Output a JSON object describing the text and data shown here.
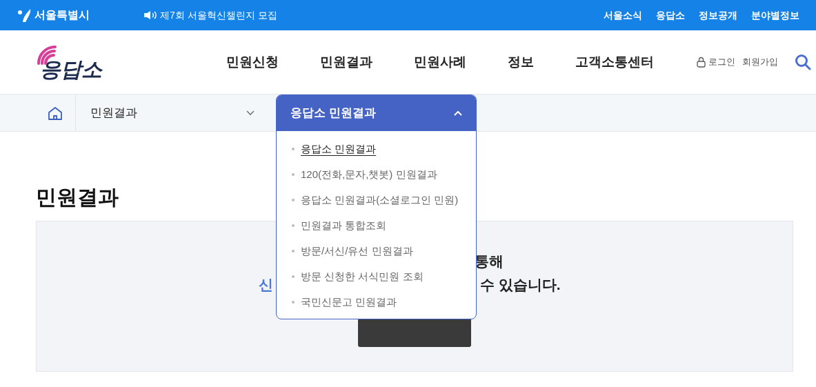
{
  "top_bar": {
    "brand": "서울특별시",
    "notice": "제7회 서울혁신챌린지 모집",
    "links": [
      "서울소식",
      "응답소",
      "정보공개",
      "분야별정보"
    ]
  },
  "header": {
    "logo": "응답소",
    "nav": [
      "민원신청",
      "민원결과",
      "민원사례",
      "정보",
      "고객소통센터"
    ],
    "login": "로그인",
    "signup": "회원가입"
  },
  "breadcrumb": {
    "section": "민원결과",
    "dropdown": {
      "title": "응답소 민원결과",
      "expanded": true,
      "items": [
        {
          "label": "응답소 민원결과",
          "selected": true
        },
        {
          "label": "120(전화,문자,챗봇) 민원결과",
          "selected": false
        },
        {
          "label": "응답소 민원결과(소셜로그인 민원)",
          "selected": false
        },
        {
          "label": "민원결과 통합조회",
          "selected": false
        },
        {
          "label": "방문/서신/유선 민원결과",
          "selected": false
        },
        {
          "label": "방문 신청한 서식민원 조회",
          "selected": false
        },
        {
          "label": "국민신문고 민원결과",
          "selected": false
        }
      ]
    }
  },
  "page": {
    "title": "민원결과",
    "line1_end": "통해",
    "line2_start": "신",
    "line2_end": "수 있습니다."
  }
}
